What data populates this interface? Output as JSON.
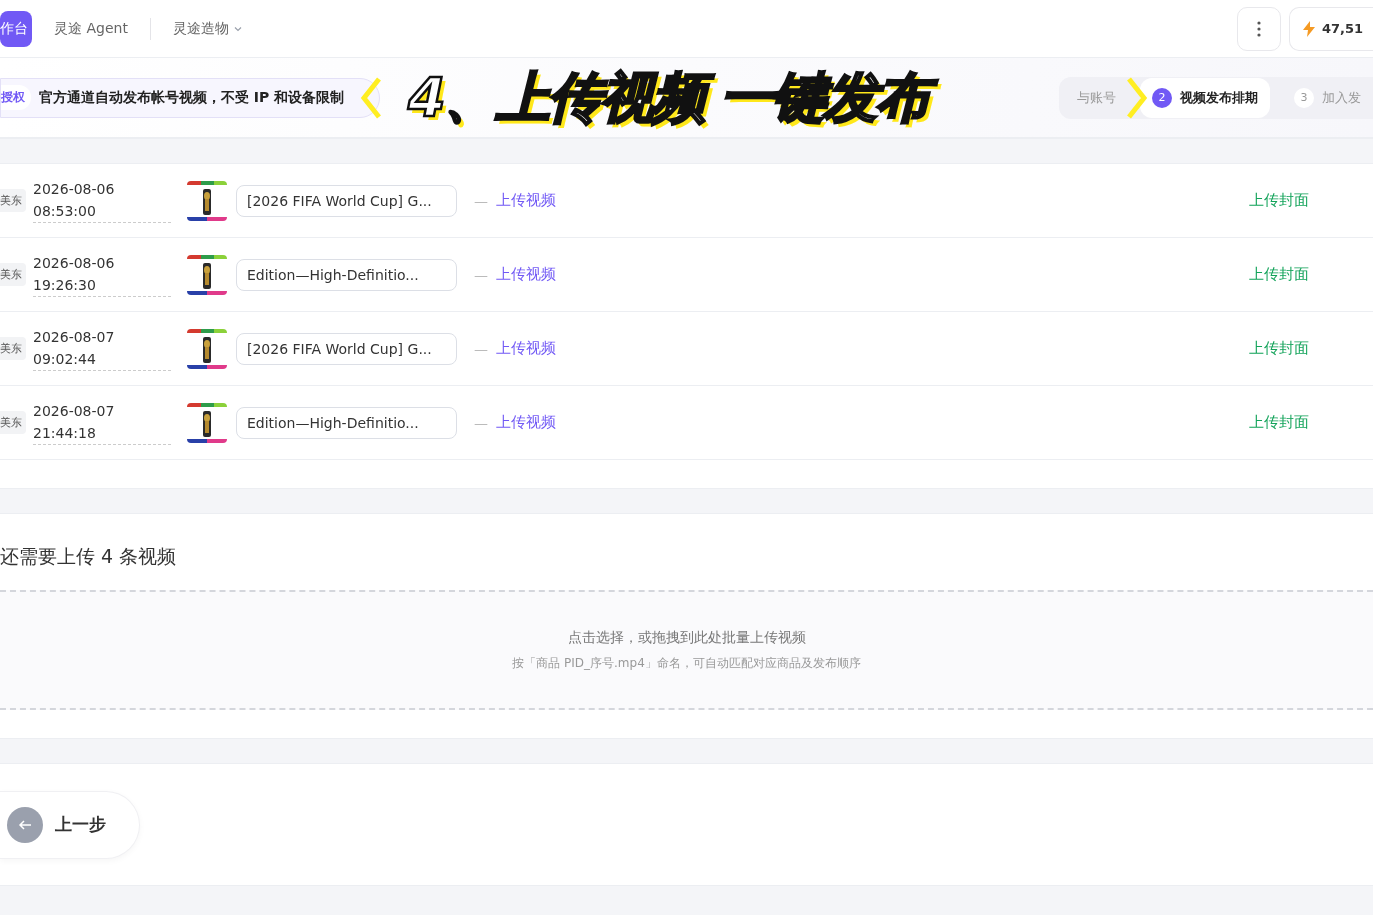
{
  "top_nav": {
    "items": [
      {
        "label": "作台",
        "selected": true
      },
      {
        "label": "灵途 Agent",
        "selected": false
      },
      {
        "label": "灵途造物",
        "selected": false,
        "dropdown": true
      }
    ],
    "credits": "47,51"
  },
  "notice": {
    "badge": "授权",
    "text": "官方通道自动发布帐号视频，不受 IP 和设备限制"
  },
  "caption": "4、上传视频 一键发布",
  "steps": [
    {
      "label": "与账号",
      "selected": false
    },
    {
      "number": "2",
      "label": "视频发布排期",
      "selected": true
    },
    {
      "number": "3",
      "label": "加入发",
      "selected": false
    }
  ],
  "schedule": [
    {
      "zone": "美东",
      "date": "2026-08-06",
      "time": "08:53:00",
      "title": "[2026 FIFA World Cup] G...",
      "dash": "—",
      "upload_video": "上传视频",
      "upload_cover": "上传封面"
    },
    {
      "zone": "美东",
      "date": "2026-08-06",
      "time": "19:26:30",
      "title": "Edition—High-Definitio...",
      "dash": "—",
      "upload_video": "上传视频",
      "upload_cover": "上传封面"
    },
    {
      "zone": "美东",
      "date": "2026-08-07",
      "time": "09:02:44",
      "title": "[2026 FIFA World Cup] G...",
      "dash": "—",
      "upload_video": "上传视频",
      "upload_cover": "上传封面"
    },
    {
      "zone": "美东",
      "date": "2026-08-07",
      "time": "21:44:18",
      "title": "Edition—High-Definitio...",
      "dash": "—",
      "upload_video": "上传视频",
      "upload_cover": "上传封面"
    }
  ],
  "upload": {
    "heading": "还需要上传 4 条视频",
    "hint": "点击选择，或拖拽到此处批量上传视频",
    "note": "按「商品 PID_序号.mp4」命名，可自动匹配对应商品及发布顺序"
  },
  "back_button": "上一步"
}
